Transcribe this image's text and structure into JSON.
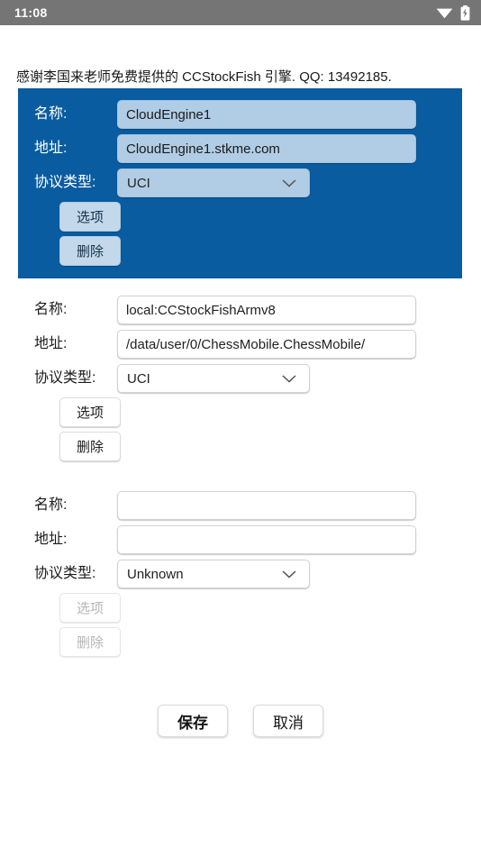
{
  "status_bar": {
    "clock": "11:08",
    "icons": [
      "wifi-icon",
      "battery-charging-icon"
    ]
  },
  "notice": "感谢李国来老师免费提供的 CCStockFish 引擎. QQ: 13492185.",
  "labels": {
    "name": "名称:",
    "address": "地址:",
    "protocol": "协议类型:",
    "options_button": "选项",
    "delete_button": "删除"
  },
  "colors": {
    "selected_card_background": "#0a5ca0",
    "selected_field_background": "#b1cde5",
    "status_bar_background": "#757575",
    "page_background": "#ffffff"
  },
  "engines": [
    {
      "selected": true,
      "name": "CloudEngine1",
      "address": "CloudEngine1.stkme.com",
      "protocol": "UCI",
      "options_enabled": true,
      "delete_enabled": true
    },
    {
      "selected": false,
      "name": "local:CCStockFishArmv8",
      "address": "/data/user/0/ChessMobile.ChessMobile/",
      "protocol": "UCI",
      "options_enabled": true,
      "delete_enabled": true
    },
    {
      "selected": false,
      "name": "",
      "address": "",
      "protocol": "Unknown",
      "options_enabled": false,
      "delete_enabled": false
    }
  ],
  "protocol_options": [
    "UCI",
    "Unknown"
  ],
  "actions": {
    "save": "保存",
    "cancel": "取消"
  }
}
